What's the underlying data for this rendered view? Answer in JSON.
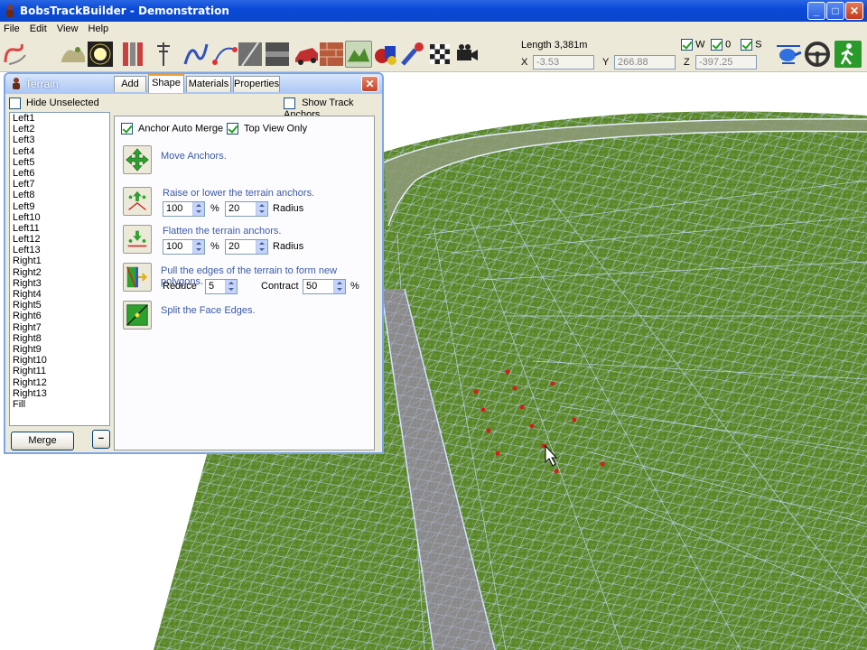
{
  "window": {
    "title": "BobsTrackBuilder - Demonstration",
    "min": "_",
    "max": "□",
    "close": "✕"
  },
  "menu": [
    "File",
    "Edit",
    "View",
    "Help"
  ],
  "toolbar": {
    "icons": [
      "track-path-icon",
      "landscape-icon",
      "sun-icon",
      "wall-icon",
      "pole-icon",
      "curve-icon",
      "spline-add-icon",
      "road-texture-icon",
      "barrier-icon",
      "car-icon",
      "brick-icon",
      "terrain-icon",
      "objects-icon",
      "paint-icon",
      "checkered-flag-icon",
      "camera-icon"
    ],
    "length_label": "Length 3,381m",
    "x_label": "X",
    "x_value": "-3.53",
    "y_label": "Y",
    "y_value": "266.88",
    "z_label": "Z",
    "z_value": "-397.25",
    "w_label": "W",
    "o_label": "0",
    "s_label": "S",
    "right_icons": [
      "helicopter-icon",
      "steering-wheel-icon",
      "walk-icon"
    ]
  },
  "panel": {
    "title": "Terrain",
    "close": "✕",
    "hide_unselected": "Hide Unselected",
    "list": [
      "Left1",
      "Left2",
      "Left3",
      "Left4",
      "Left5",
      "Left6",
      "Left7",
      "Left8",
      "Left9",
      "Left10",
      "Left11",
      "Left12",
      "Left13",
      "Right1",
      "Right2",
      "Right3",
      "Right4",
      "Right5",
      "Right6",
      "Right7",
      "Right8",
      "Right9",
      "Right10",
      "Right11",
      "Right12",
      "Right13",
      "Fill"
    ],
    "merge": "Merge",
    "minus": "−",
    "tabs": [
      "Add",
      "Shape",
      "Materials",
      "Properties"
    ],
    "show_track_anchors": "Show Track Anchors",
    "anchor_auto_merge": "Anchor Auto Merge",
    "top_view_only": "Top View Only",
    "move_anchors": "Move Anchors.",
    "raise_lower": "Raise or lower the terrain anchors.",
    "raise_value": "100",
    "raise_radius": "20",
    "flatten": "Flatten the terrain anchors.",
    "flatten_value": "100",
    "flatten_radius": "20",
    "percent": "%",
    "radius": "Radius",
    "pull_edges": "Pull the edges of the terrain to form new polygons.",
    "reduce_label": "Reduce",
    "reduce_value": "5",
    "contract_label": "Contract",
    "contract_value": "50",
    "split_faces": "Split the Face Edges."
  },
  "colors": {
    "grass": "#5f8a2e",
    "road": "#8d8d8d",
    "wire": "#b4c8ff",
    "anchor": "#d21e1e",
    "titlebar": "#0a4ad8"
  }
}
